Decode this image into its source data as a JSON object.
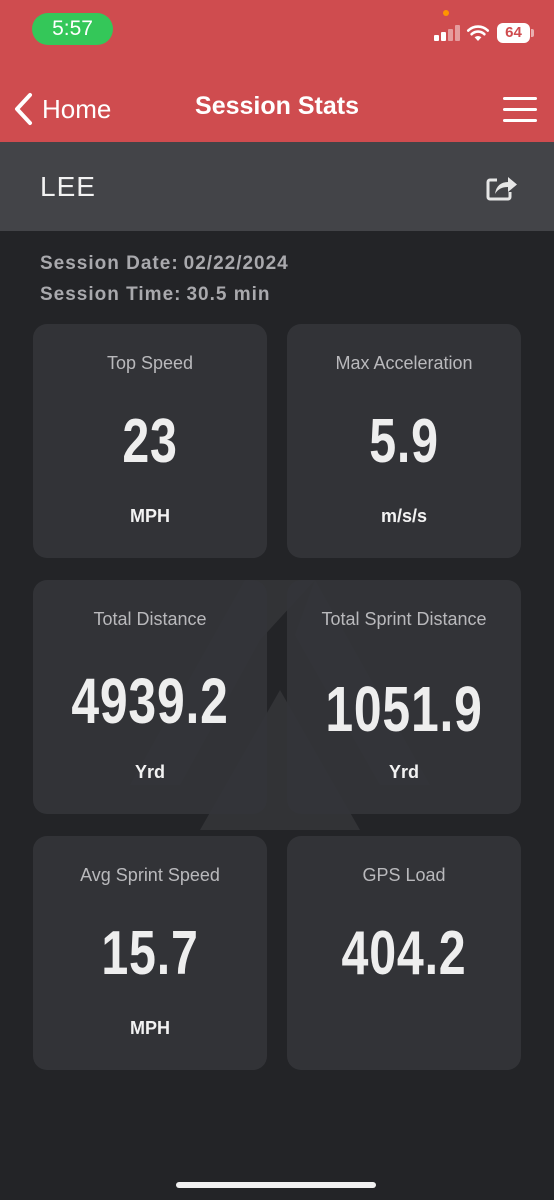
{
  "status_bar": {
    "time": "5:57",
    "battery": "64"
  },
  "nav": {
    "back_label": "Home",
    "title": "Session Stats"
  },
  "athlete": {
    "name": "LEE"
  },
  "session": {
    "date_label": "Session Date:",
    "date_value": "02/22/2024",
    "time_label": "Session Time:",
    "time_value": "30.5 min"
  },
  "stats": [
    {
      "label": "Top Speed",
      "value": "23",
      "unit": "MPH"
    },
    {
      "label": "Max Acceleration",
      "value": "5.9",
      "unit": "m/s/s"
    },
    {
      "label": "Total Distance",
      "value": "4939.2",
      "unit": "Yrd"
    },
    {
      "label": "Total Sprint Distance",
      "value": "1051.9",
      "unit": "Yrd"
    },
    {
      "label": "Avg Sprint Speed",
      "value": "15.7",
      "unit": "MPH"
    },
    {
      "label": "GPS Load",
      "value": "404.2",
      "unit": ""
    }
  ],
  "colors": {
    "header": "#cf4c4f",
    "time_pill": "#34c759",
    "athlete_bar": "#434448",
    "background": "#232427",
    "card": "#343539"
  },
  "icons": {
    "back": "chevron-left-icon",
    "menu": "hamburger-menu-icon",
    "share": "share-icon"
  }
}
